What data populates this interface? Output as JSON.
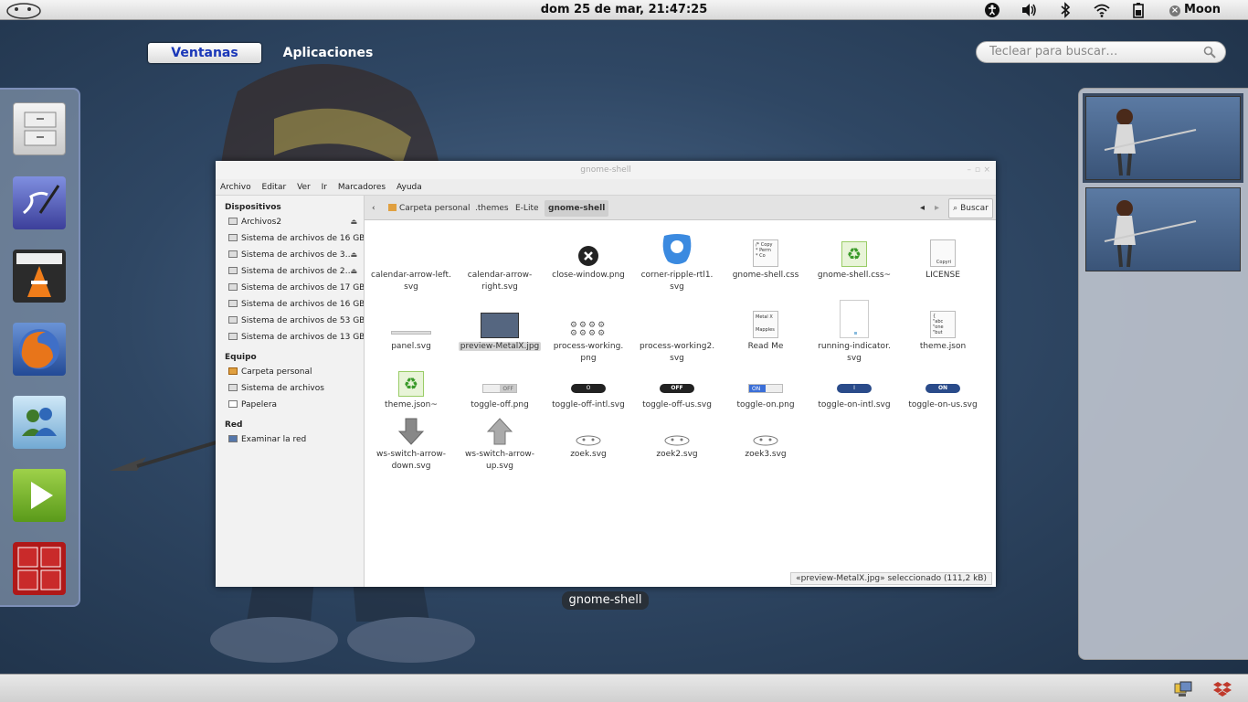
{
  "top_panel": {
    "clock": "dom 25 de mar, 21:47:25",
    "user": "Moon",
    "tray_icons": [
      "accessibility-icon",
      "volume-icon",
      "bluetooth-icon",
      "wifi-icon",
      "battery-icon"
    ]
  },
  "view_selector": {
    "windows": "Ventanas",
    "applications": "Aplicaciones"
  },
  "search": {
    "placeholder": "Teclear para buscar…"
  },
  "dash": [
    "file-cabinet",
    "text-editor",
    "vlc",
    "firefox",
    "messenger",
    "media-player",
    "terminal"
  ],
  "window": {
    "title": "gnome-shell",
    "menu": [
      "Archivo",
      "Editar",
      "Ver",
      "Ir",
      "Marcadores",
      "Ayuda"
    ],
    "sidebar": {
      "devices_header": "Dispositivos",
      "devices": [
        "Archivos2",
        "Sistema de archivos de 16 GB",
        "Sistema de archivos de 3…",
        "Sistema de archivos de 2…",
        "Sistema de archivos de 17 GB",
        "Sistema de archivos de 16 GB",
        "Sistema de archivos de 53 GB",
        "Sistema de archivos de 13 GB"
      ],
      "computer_header": "Equipo",
      "computer": [
        "Carpeta personal",
        "Sistema de archivos",
        "Papelera"
      ],
      "network_header": "Red",
      "network": [
        "Examinar la red"
      ]
    },
    "breadcrumbs": [
      "Carpeta personal",
      ".themes",
      "E-Lite",
      "gnome-shell"
    ],
    "search_button": "Buscar",
    "files": [
      [
        "calendar-arrow-left.",
        "svg"
      ],
      [
        "calendar-arrow-",
        "right.svg"
      ],
      [
        "close-window.png"
      ],
      [
        "corner-ripple-rtl1.",
        "svg"
      ],
      [
        "gnome-shell.css"
      ],
      [
        "gnome-shell.css~"
      ],
      [
        "LICENSE"
      ],
      [
        "panel.svg"
      ],
      [
        "preview-MetalX.jpg"
      ],
      [
        "process-working.",
        "png"
      ],
      [
        "process-working2.",
        "svg"
      ],
      [
        "Read Me"
      ],
      [
        "running-indicator.",
        "svg"
      ],
      [
        "theme.json"
      ],
      [
        "theme.json~"
      ],
      [
        "toggle-off.png"
      ],
      [
        "toggle-off-intl.svg"
      ],
      [
        "toggle-off-us.svg"
      ],
      [
        "toggle-on.png"
      ],
      [
        "toggle-on-intl.svg"
      ],
      [
        "toggle-on-us.svg"
      ],
      [
        "ws-switch-arrow-",
        "down.svg"
      ],
      [
        "ws-switch-arrow-",
        "up.svg"
      ],
      [
        "zoek.svg"
      ],
      [
        "zoek2.svg"
      ],
      [
        "zoek3.svg"
      ]
    ],
    "selected_file": "preview-MetalX.jpg",
    "status": "«preview-MetalX.jpg» seleccionado (111,2 kB)",
    "toggle_text": {
      "off": "OFF",
      "off_intl": "O",
      "on": "ON",
      "on_intl": "I"
    },
    "file_thumbs": {
      "corner_ripple": "corner-ripple-icon",
      "css_text": [
        "/* Copy",
        " * Perm",
        " * Co"
      ],
      "license_text": "Copyri",
      "readme_text": [
        "Metal X",
        "Mapples"
      ],
      "theme_text": [
        "{",
        " \"abc",
        " \"one",
        " \"but"
      ]
    }
  },
  "window_caption": "gnome-shell",
  "colors": {
    "accent": "#1a37b8",
    "selection": "#d6d6d6",
    "toggle_on": "#3b6fd8"
  }
}
